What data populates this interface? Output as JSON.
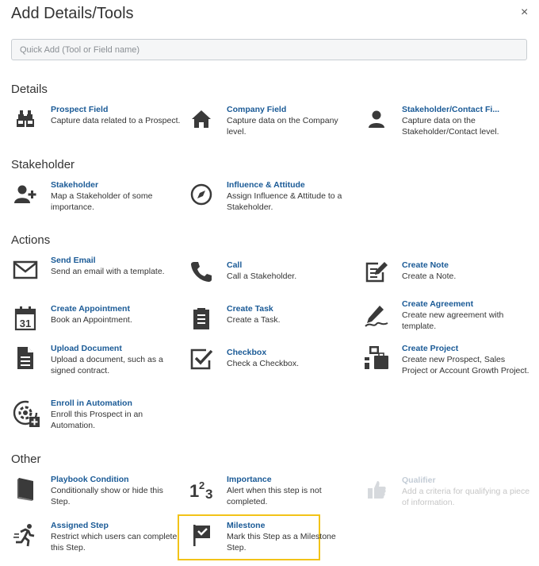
{
  "dialog": {
    "title": "Add Details/Tools",
    "close_glyph": "×"
  },
  "search": {
    "placeholder": "Quick Add (Tool or Field name)"
  },
  "sections": {
    "details": {
      "title": "Details",
      "items": [
        {
          "label": "Prospect Field",
          "desc": "Capture data related to a Prospect.",
          "icon": "binoculars-icon"
        },
        {
          "label": "Company Field",
          "desc": "Capture data on the Company level.",
          "icon": "home-icon"
        },
        {
          "label": "Stakeholder/Contact Fi...",
          "desc": "Capture data on the Stakeholder/Contact level.",
          "icon": "user-icon"
        }
      ]
    },
    "stakeholder": {
      "title": "Stakeholder",
      "items": [
        {
          "label": "Stakeholder",
          "desc": "Map a Stakeholder of some importance.",
          "icon": "add-user-icon"
        },
        {
          "label": "Influence & Attitude",
          "desc": "Assign Influence & Attitude to a Stakeholder.",
          "icon": "compass-icon"
        }
      ]
    },
    "actions": {
      "title": "Actions",
      "items": [
        {
          "label": "Send Email",
          "desc": "Send an email with a template.",
          "icon": "envelope-icon"
        },
        {
          "label": "Call",
          "desc": "Call a Stakeholder.",
          "icon": "phone-icon"
        },
        {
          "label": "Create Note",
          "desc": "Create a Note.",
          "icon": "edit-note-icon"
        },
        {
          "label": "Create Appointment",
          "desc": "Book an Appointment.",
          "icon": "calendar-icon",
          "calendar_day": "31"
        },
        {
          "label": "Create Task",
          "desc": "Create a Task.",
          "icon": "clipboard-icon"
        },
        {
          "label": "Create Agreement",
          "desc": "Create new agreement with template.",
          "icon": "signature-icon"
        },
        {
          "label": "Upload Document",
          "desc": "Upload a document, such as a signed contract.",
          "icon": "document-icon"
        },
        {
          "label": "Checkbox",
          "desc": "Check a Checkbox.",
          "icon": "checkbox-icon"
        },
        {
          "label": "Create Project",
          "desc": "Create new Prospect, Sales Project or Account Growth Project.",
          "icon": "project-icon"
        },
        {
          "label": "Enroll in Automation",
          "desc": "Enroll this Prospect in an Automation.",
          "icon": "automation-icon"
        }
      ]
    },
    "other": {
      "title": "Other",
      "items": [
        {
          "label": "Playbook Condition",
          "desc": "Conditionally show or hide this Step.",
          "icon": "book-icon"
        },
        {
          "label": "Importance",
          "desc": "Alert when this step is not completed.",
          "icon": "importance-icon",
          "icon_text": "123"
        },
        {
          "label": "Qualifier",
          "desc": "Add a criteria for qualifying a piece of information.",
          "icon": "thumbs-up-icon",
          "disabled": true
        },
        {
          "label": "Assigned Step",
          "desc": "Restrict which users can complete this Step.",
          "icon": "running-person-icon"
        },
        {
          "label": "Milestone",
          "desc": "Mark this Step as a Milestone Step.",
          "icon": "flag-icon",
          "highlighted": true
        }
      ]
    }
  },
  "colors": {
    "link": "#1a5a96",
    "icon": "#3a3a3a",
    "highlight_border": "#f2c318",
    "disabled": "#c3ccd6"
  }
}
